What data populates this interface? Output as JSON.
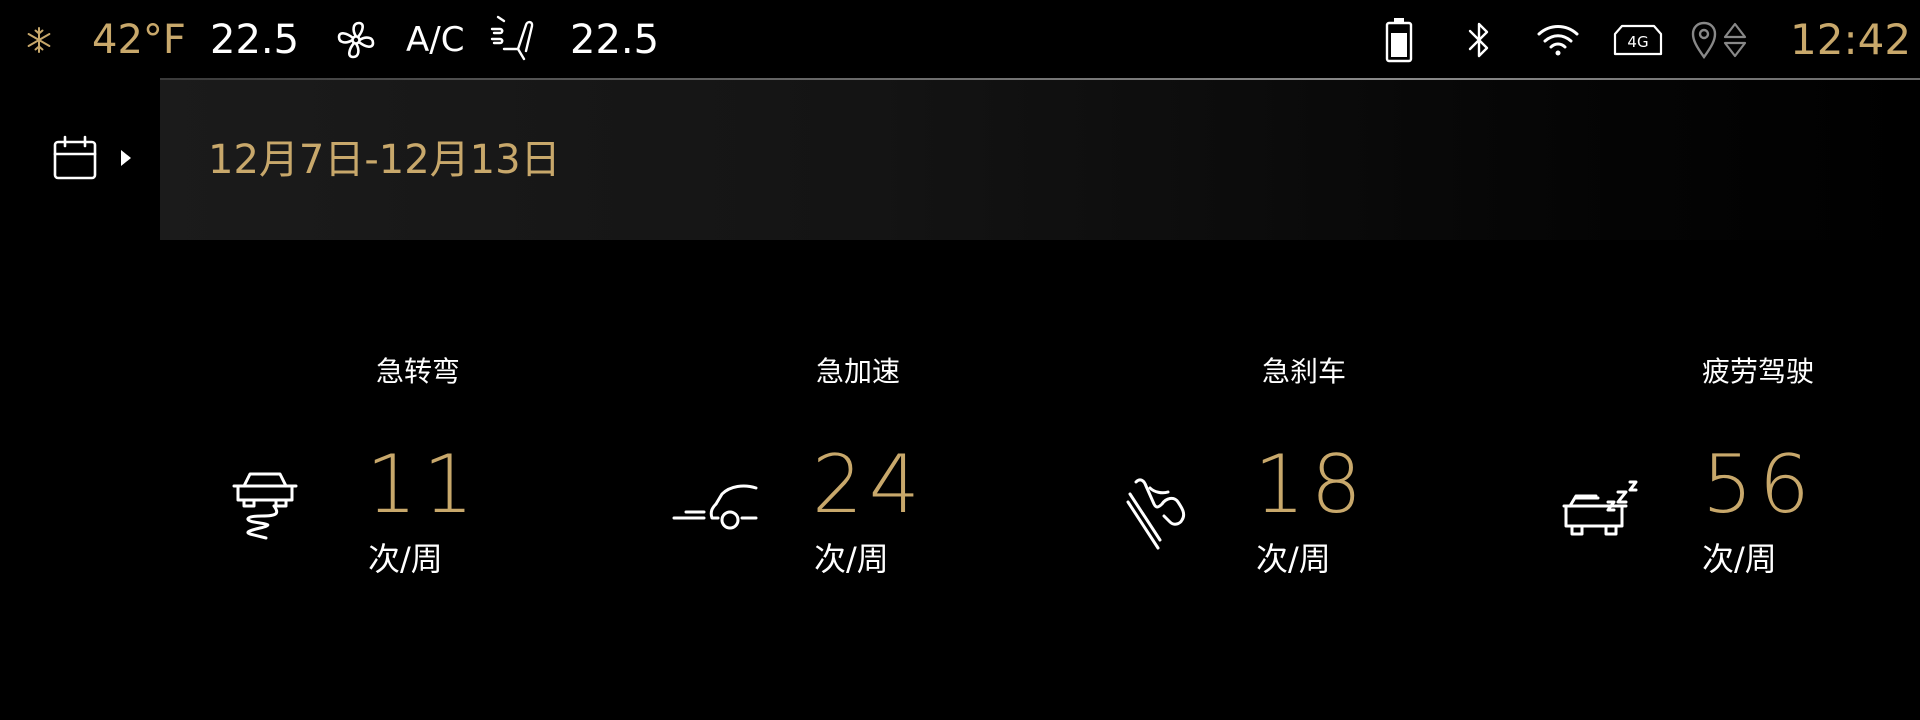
{
  "status_bar": {
    "outside_temp": "42°F",
    "left_temp": "22.5",
    "ac_label": "A/C",
    "right_temp": "22.5",
    "clock": "12:42",
    "icons": [
      "snowflake-icon",
      "fan-icon",
      "seat-airflow-icon",
      "battery-icon",
      "bluetooth-icon",
      "wifi-icon",
      "4g-icon",
      "location-icon",
      "sort-arrows-icon"
    ]
  },
  "date_header": {
    "icon": "calendar-icon",
    "range": "12月7日-12月13日"
  },
  "stats": [
    {
      "label": "急转弯",
      "value": "11",
      "unit": "次/周",
      "icon": "sharp-turn-icon"
    },
    {
      "label": "急加速",
      "value": "24",
      "unit": "次/周",
      "icon": "rapid-acceleration-icon"
    },
    {
      "label": "急刹车",
      "value": "18",
      "unit": "次/周",
      "icon": "hard-braking-icon"
    },
    {
      "label": "疲劳驾驶",
      "value": "56",
      "unit": "次/周",
      "icon": "fatigue-driving-icon"
    }
  ],
  "colors": {
    "accent_gold": "#c8a86b",
    "background": "#000000",
    "text": "#ffffff"
  }
}
